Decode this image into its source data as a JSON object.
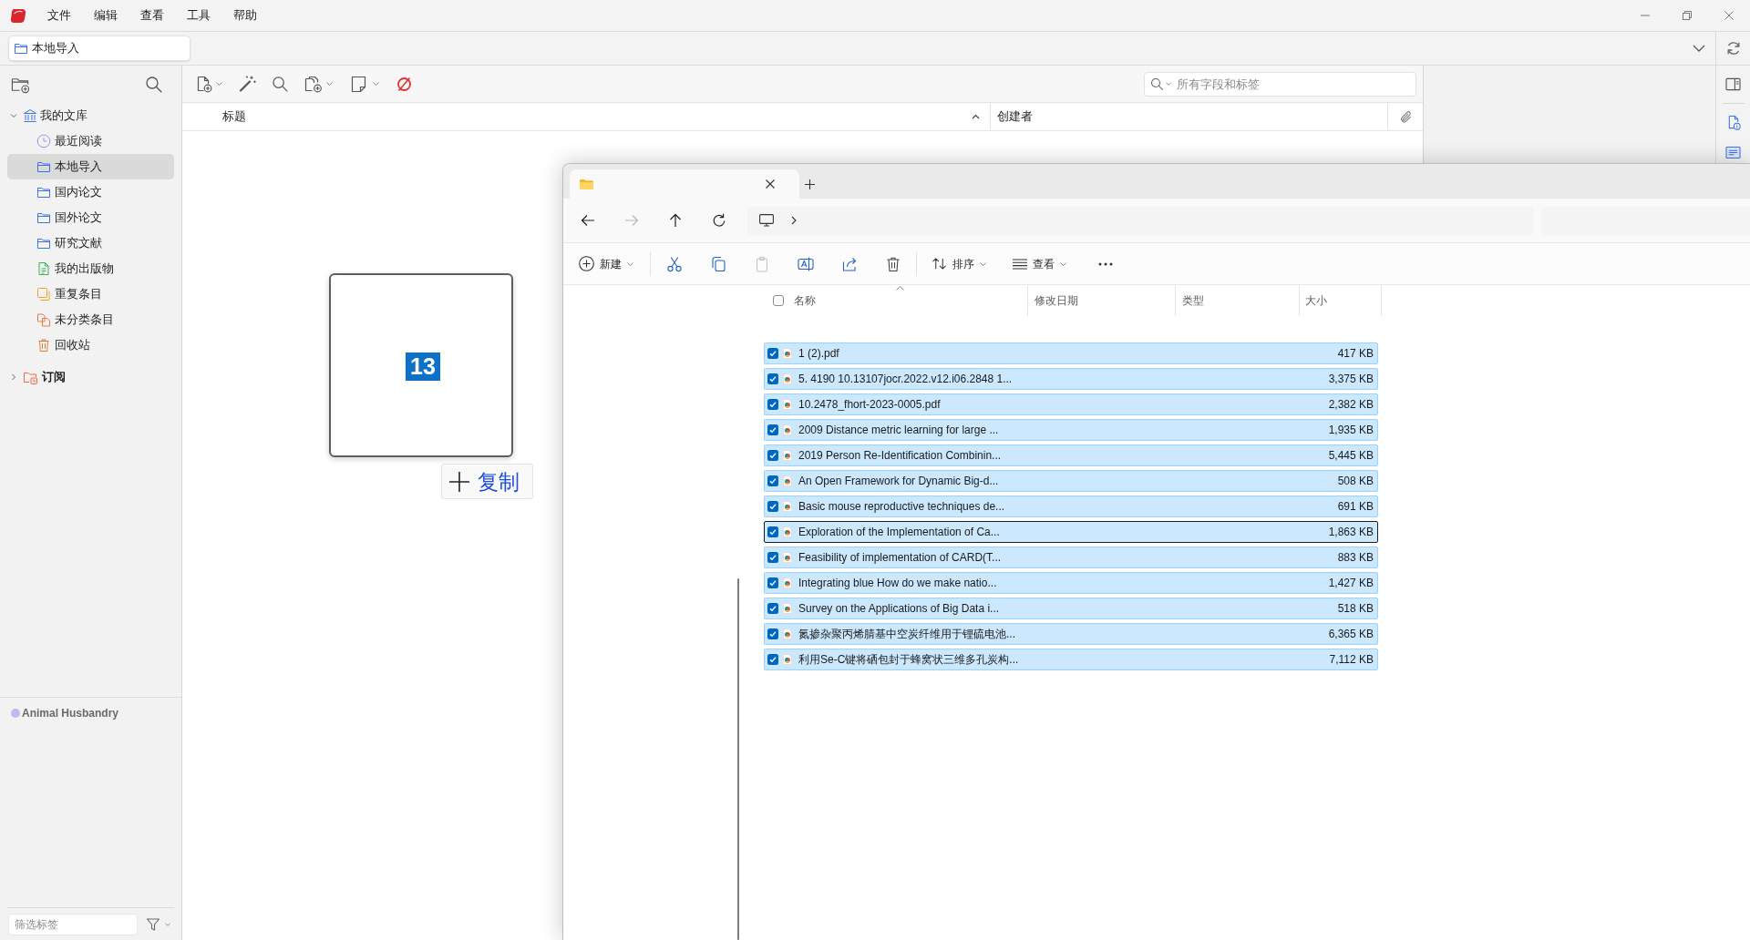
{
  "menu": [
    "文件",
    "编辑",
    "查看",
    "工具",
    "帮助"
  ],
  "tabs": [
    {
      "label": "本地导入",
      "selected": true
    }
  ],
  "sidebar": {
    "tree": [
      {
        "label": "我的文库",
        "kind": "library",
        "expanded": true,
        "unread": false,
        "selected": false,
        "children": [
          {
            "label": "最近阅读",
            "kind": "recent",
            "selected": false
          },
          {
            "label": "本地导入",
            "kind": "collection",
            "selected": true
          },
          {
            "label": "国内论文",
            "kind": "collection",
            "selected": false
          },
          {
            "label": "国外论文",
            "kind": "collection",
            "selected": false
          },
          {
            "label": "研究文献",
            "kind": "collection",
            "selected": false
          },
          {
            "label": "我的出版物",
            "kind": "publications",
            "selected": false
          },
          {
            "label": "重复条目",
            "kind": "duplicates",
            "selected": false
          },
          {
            "label": "未分类条目",
            "kind": "unfiled",
            "selected": false
          },
          {
            "label": "回收站",
            "kind": "trash",
            "selected": false
          }
        ]
      },
      {
        "label": "订阅",
        "kind": "feeds",
        "expanded": false,
        "unread": true,
        "selected": false
      }
    ],
    "tags": [
      {
        "label": "Animal Husbandry",
        "color": "#c8b4ee"
      }
    ],
    "tag_filter": {
      "placeholder": "筛选标签"
    }
  },
  "toolbar": {
    "search": {
      "placeholder": "所有字段和标签"
    }
  },
  "items_table": {
    "columns": [
      {
        "label": "标题",
        "sorted": true
      },
      {
        "label": "创建者",
        "sorted": false
      }
    ]
  },
  "drag_preview": {
    "count": "13",
    "action": "复制"
  },
  "explorer": {
    "tabs": [
      {
        "selected": true
      }
    ],
    "nav_buttons": [
      {
        "kind": "back",
        "disabled": false
      },
      {
        "kind": "forward",
        "disabled": true
      },
      {
        "kind": "up",
        "disabled": false
      },
      {
        "kind": "refresh",
        "disabled": false
      }
    ],
    "commands": [
      {
        "kind": "new",
        "label": "新建",
        "disabled": false
      },
      {
        "kind": "cut",
        "disabled": false
      },
      {
        "kind": "copy",
        "disabled": false
      },
      {
        "kind": "paste",
        "disabled": true
      },
      {
        "kind": "rename",
        "disabled": false
      },
      {
        "kind": "share",
        "disabled": false
      },
      {
        "kind": "delete",
        "disabled": false
      },
      {
        "kind": "sort",
        "label": "排序",
        "disabled": false
      },
      {
        "kind": "view",
        "label": "查看",
        "disabled": false
      },
      {
        "kind": "more",
        "disabled": false
      }
    ],
    "select_all_checked": false,
    "columns": [
      {
        "label": "名称",
        "sorted": true
      },
      {
        "label": "修改日期",
        "sorted": false
      },
      {
        "label": "类型",
        "sorted": false
      },
      {
        "label": "大小",
        "sorted": false
      }
    ],
    "files": [
      {
        "name": "1 (2).pdf",
        "size": "417 KB",
        "checked": true,
        "selected": true,
        "focused": false
      },
      {
        "name": "5. 4190 10.13107jocr.2022.v12.i06.2848 1...",
        "size": "3,375 KB",
        "checked": true,
        "selected": true,
        "focused": false
      },
      {
        "name": "10.2478_fhort-2023-0005.pdf",
        "size": "2,382 KB",
        "checked": true,
        "selected": true,
        "focused": false
      },
      {
        "name": "2009 Distance metric learning for large ...",
        "size": "1,935 KB",
        "checked": true,
        "selected": true,
        "focused": false
      },
      {
        "name": "2019 Person Re-Identification Combinin...",
        "size": "5,445 KB",
        "checked": true,
        "selected": true,
        "focused": false
      },
      {
        "name": "An Open Framework for Dynamic Big-d...",
        "size": "508 KB",
        "checked": true,
        "selected": true,
        "focused": false
      },
      {
        "name": "Basic mouse reproductive techniques de...",
        "size": "691 KB",
        "checked": true,
        "selected": true,
        "focused": false
      },
      {
        "name": "Exploration of the Implementation of Ca...",
        "size": "1,863 KB",
        "checked": true,
        "selected": true,
        "focused": true
      },
      {
        "name": "Feasibility of implementation of CARD(T...",
        "size": "883 KB",
        "checked": true,
        "selected": true,
        "focused": false
      },
      {
        "name": "Integrating blue How do we make natio...",
        "size": "1,427 KB",
        "checked": true,
        "selected": true,
        "focused": false
      },
      {
        "name": "Survey on the Applications of Big Data i...",
        "size": "518 KB",
        "checked": true,
        "selected": true,
        "focused": false
      },
      {
        "name": "氮掺杂聚丙烯腈基中空炭纤维用于锂硫电池...",
        "size": "6,365 KB",
        "checked": true,
        "selected": true,
        "focused": false
      },
      {
        "name": "利用Se-C键将硒包封于蜂窝状三维多孔炭构...",
        "size": "7,112 KB",
        "checked": true,
        "selected": true,
        "focused": false
      }
    ]
  }
}
